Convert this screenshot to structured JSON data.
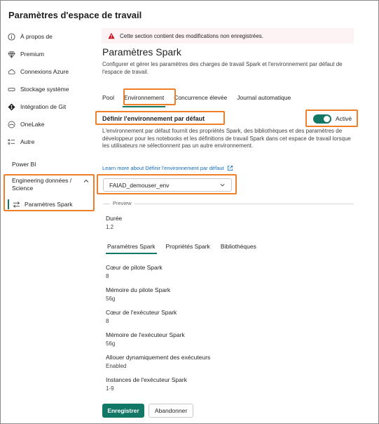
{
  "window_title": "Paramètres d'espace de travail",
  "sidebar": {
    "items": [
      {
        "label": "À propos de",
        "icon": "info-icon"
      },
      {
        "label": "Premium",
        "icon": "diamond-icon"
      },
      {
        "label": "Connexions Azure",
        "icon": "cloud-icon"
      },
      {
        "label": "Stockage système",
        "icon": "storage-icon"
      },
      {
        "label": "Intégration de Git",
        "icon": "git-icon"
      },
      {
        "label": "OneLake",
        "icon": "onelake-icon"
      },
      {
        "label": "Autre",
        "icon": "list-icon"
      }
    ],
    "section_powerbi": "Power BI",
    "section_engineering": "Engineering données / Science",
    "sub_item": "Paramètres Spark"
  },
  "warning": "Cette section contient des modifications non enregistrées.",
  "page": {
    "title": "Paramètres Spark",
    "description": "Configurer et gérer les paramètres des charges de travail Spark et l'environnement par défaut de l'espace de travail."
  },
  "tabs": [
    "Pool",
    "Environnement",
    "Concurrence élevée",
    "Journal automatique"
  ],
  "default_env": {
    "heading": "Définir l'environnement par défaut",
    "toggle_label": "Activé",
    "description": "L'environnement par défaut fournit des propriétés Spark, des bibliothèques et des paramètres de développeur pour les notebooks et les définitions de travail Spark dans cet espace de travail lorsque les utilisateurs ne sélectionnent pas un autre environnement.",
    "learn_more": "Learn more about Définir l'environnement par défaut",
    "selected_env": "FAIAD_demouser_env"
  },
  "preview": {
    "label": "Preview",
    "duree_label": "Durée",
    "duree_value": "1.2",
    "subtabs": [
      "Paramètres Spark",
      "Propriétés Spark",
      "Bibliothèques"
    ],
    "fields": [
      {
        "label": "Cœur de pilote Spark",
        "value": "8"
      },
      {
        "label": "Mémoire du pilote Spark",
        "value": "56g"
      },
      {
        "label": "Cœur de l'exécuteur Spark",
        "value": "8"
      },
      {
        "label": "Mémoire de l'exécuteur Spark",
        "value": "56g"
      },
      {
        "label": "Allouer dynamiquement des exécuteurs",
        "value": "Enabled"
      },
      {
        "label": "Instances de l'exécuteur Spark",
        "value": "1-9"
      }
    ]
  },
  "buttons": {
    "save": "Enregistrer",
    "discard": "Abandonner"
  },
  "colors": {
    "accent": "#117865",
    "highlight": "#f07f2a",
    "warning_bg": "#fdf3f4",
    "warning_icon": "#c50f1f"
  }
}
